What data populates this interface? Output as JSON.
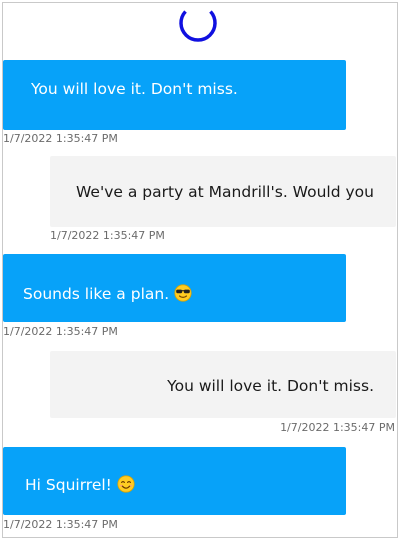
{
  "colors": {
    "incoming_bubble": "#07a2f9",
    "outgoing_bubble": "#f3f3f3",
    "spinner": "#1010e0",
    "timestamp": "#6b6b6b"
  },
  "loading": {
    "icon": "loading-spinner-icon"
  },
  "messages": [
    {
      "direction": "incoming",
      "text": "You will love it. Don't miss.",
      "timestamp": "1/7/2022 1:35:47 PM"
    },
    {
      "direction": "outgoing",
      "text": "We've a party at Mandrill's. Would you",
      "timestamp": "1/7/2022 1:35:47 PM"
    },
    {
      "direction": "incoming",
      "text": "Sounds like a plan.",
      "emoji": "sunglasses-face-emoji",
      "timestamp": "1/7/2022 1:35:47 PM"
    },
    {
      "direction": "outgoing",
      "text": "You will love it. Don't miss.",
      "timestamp": "1/7/2022 1:35:47 PM"
    },
    {
      "direction": "incoming",
      "text": "Hi Squirrel!",
      "emoji": "smiling-face-emoji",
      "timestamp": "1/7/2022 1:35:47 PM"
    }
  ]
}
